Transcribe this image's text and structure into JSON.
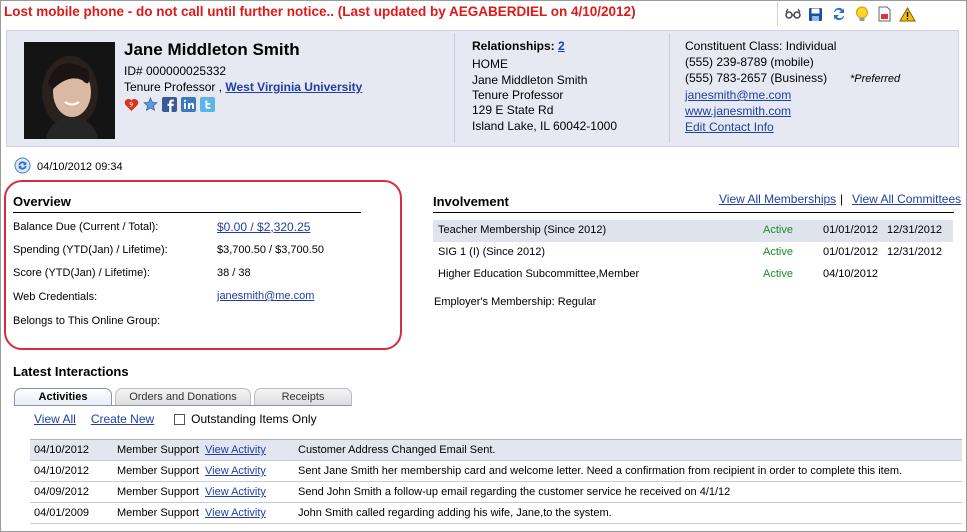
{
  "alert": {
    "text": "Lost mobile phone - do not call until further notice.. (Last updated by AEGABERDIEL on 4/10/2012)"
  },
  "toolbar": {
    "icons": [
      "glasses-icon",
      "save-icon",
      "refresh-icon",
      "lightbulb-icon",
      "document-icon",
      "warning-icon"
    ]
  },
  "profile": {
    "name": "Jane Middleton Smith",
    "id": "ID# 000000025332",
    "title_prefix": "Tenure Professor ,",
    "organization": "West Virginia University"
  },
  "relationships": {
    "label": "Relationships:",
    "count": "2",
    "address_type": "HOME",
    "name": "Jane Middleton Smith",
    "title": "Tenure Professor",
    "street": "129 E State Rd",
    "city": "Island Lake, IL 60042-1000"
  },
  "contact": {
    "class": "Constituent Class: Individual",
    "mobile": "(555) 239-8789 (mobile)",
    "business": "(555) 783-2657 (Business)",
    "preferred": "*Preferred",
    "email": "janesmith@me.com",
    "website": "www.janesmith.com",
    "edit_link": "Edit Contact Info"
  },
  "timestamp": "04/10/2012 09:34",
  "overview": {
    "title": "Overview",
    "rows": [
      {
        "label": "Balance Due (Current / Total):",
        "value": "$0.00 / $2,320.25"
      },
      {
        "label": "Spending (YTD(Jan) / Lifetime):",
        "value": "$3,700.50 / $3,700.50"
      },
      {
        "label": "Score (YTD(Jan) / Lifetime):",
        "value": "38 / 38"
      },
      {
        "label": "Web Credentials:",
        "value": "janesmith@me.com"
      },
      {
        "label": "Belongs to This Online Group:",
        "value": ""
      }
    ]
  },
  "involvement": {
    "title": "Involvement",
    "link_memberships": "View All Memberships",
    "separator": "|",
    "link_committees": "View All Committees",
    "rows": [
      {
        "name": "Teacher Membership (Since 2012)",
        "status": "Active",
        "start": "01/01/2012",
        "end": "12/31/2012"
      },
      {
        "name": "SIG 1 (I) (Since 2012)",
        "status": "Active",
        "start": "01/01/2012",
        "end": "12/31/2012"
      },
      {
        "name": "Higher Education Subcommittee,Member",
        "status": "Active",
        "start": "04/10/2012",
        "end": ""
      }
    ],
    "employer": "Employer's Membership: Regular"
  },
  "interactions": {
    "title": "Latest Interactions",
    "tabs": [
      "Activities",
      "Orders and Donations",
      "Receipts"
    ],
    "view_all": "View All",
    "create_new": "Create New",
    "outstanding": "Outstanding Items Only",
    "rows": [
      {
        "date": "04/10/2012",
        "type": "Member Support",
        "link": "View Activity",
        "desc": "Customer Address Changed Email Sent."
      },
      {
        "date": "04/10/2012",
        "type": "Member Support",
        "link": "View Activity",
        "desc": "Sent Jane Smith her membership card and welcome letter. Need a confirmation from recipient in order to complete this item."
      },
      {
        "date": "04/09/2012",
        "type": "Member Support",
        "link": "View Activity",
        "desc": "Send John Smith a follow-up email regarding the customer service he received on 4/1/12"
      },
      {
        "date": "04/01/2009",
        "type": "Member Support",
        "link": "View Activity",
        "desc": "John Smith called regarding adding his wife, Jane,to the system."
      }
    ]
  }
}
